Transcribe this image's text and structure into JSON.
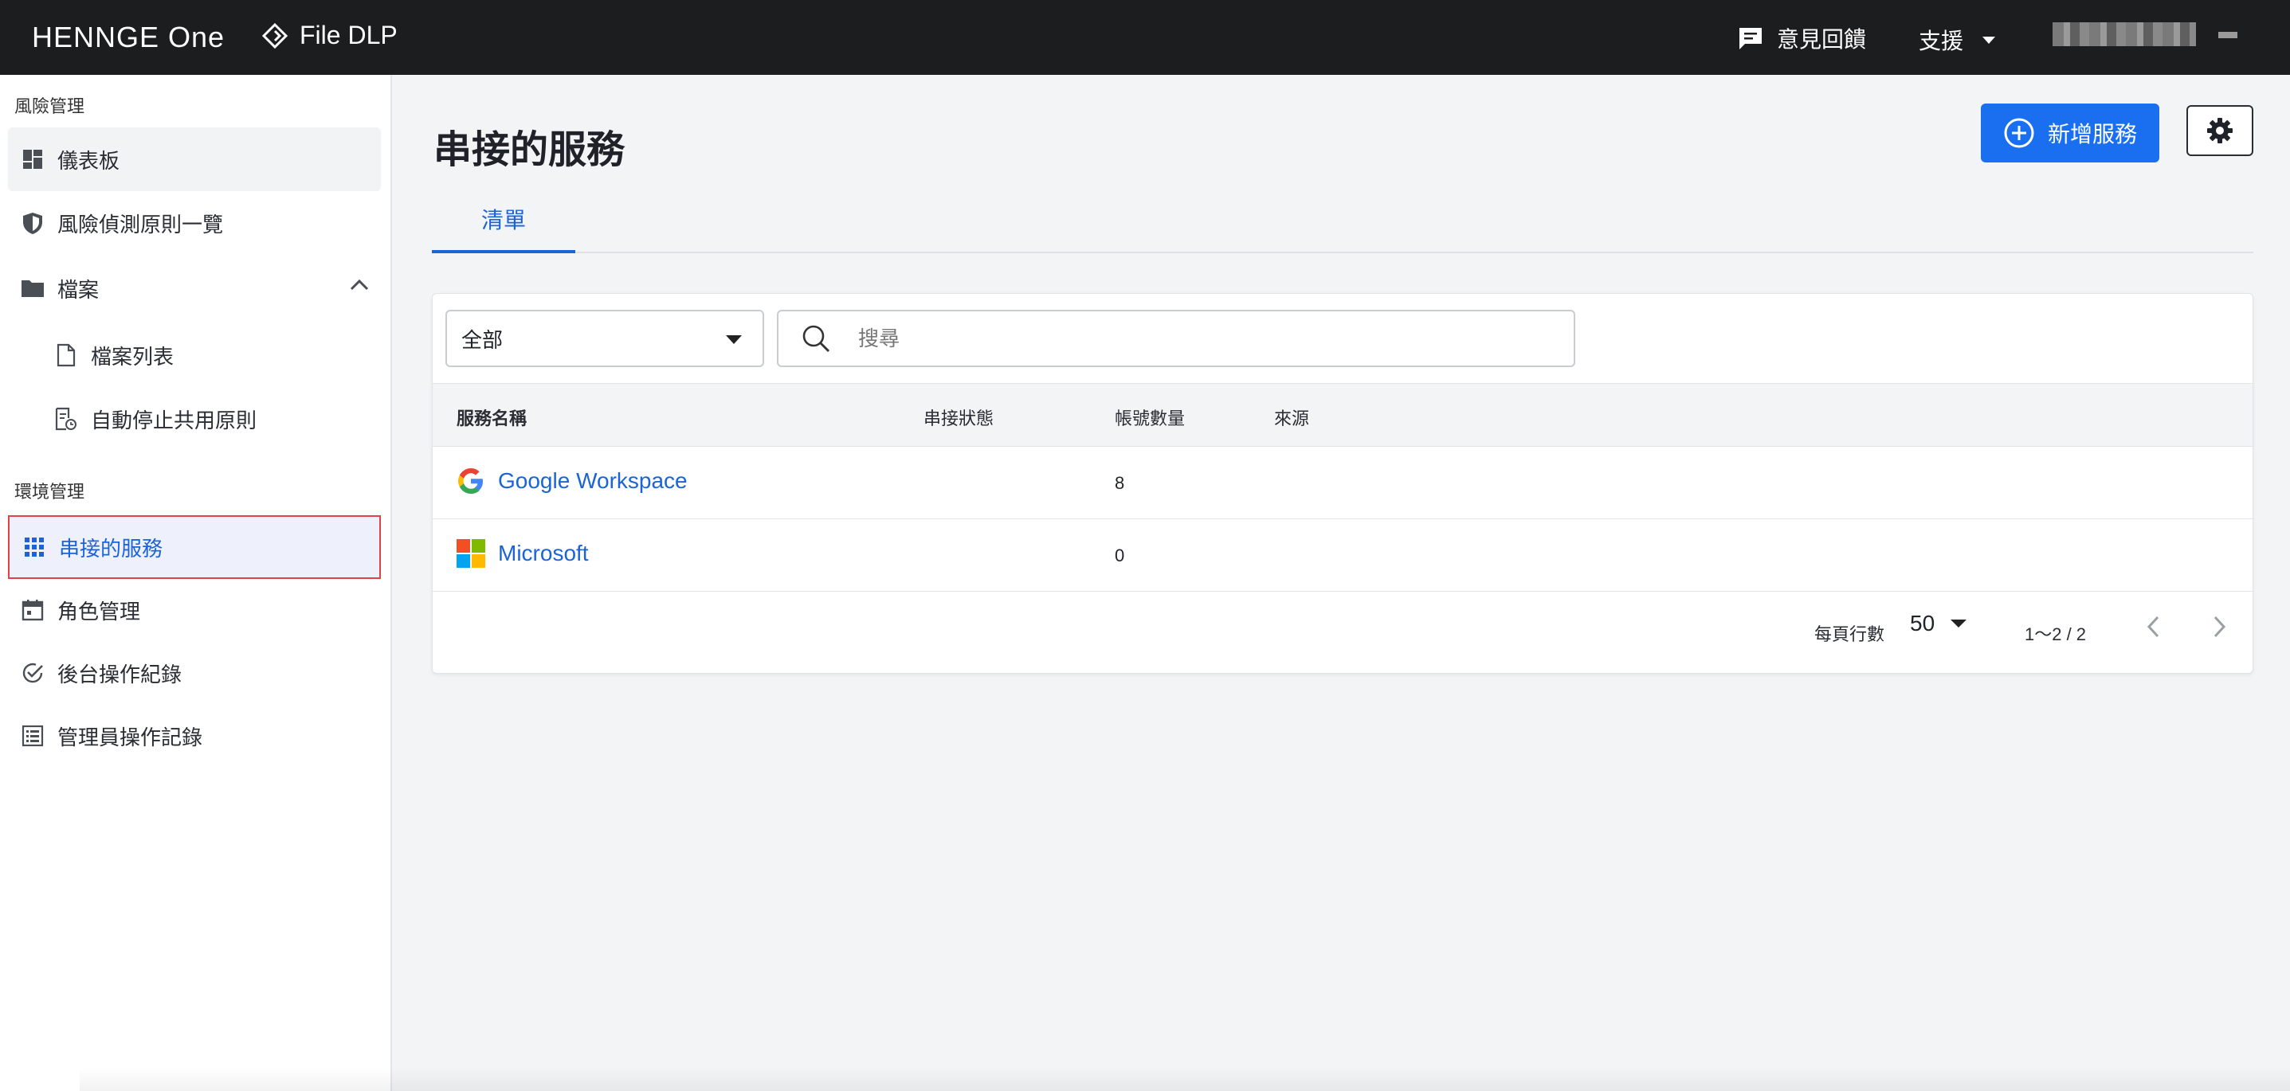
{
  "header": {
    "brand": "HENNGE One",
    "product": "File DLP",
    "feedback_label": "意見回饋",
    "support_label": "支援"
  },
  "sidebar": {
    "section_risk": "風險管理",
    "section_env": "環境管理",
    "items": {
      "dashboard": "儀表板",
      "risk_rules": "風險偵測原則一覽",
      "files": "檔案",
      "file_list": "檔案列表",
      "auto_stop": "自動停止共用原則",
      "connected_services": "串接的服務",
      "roles": "角色管理",
      "backend_logs": "後台操作紀錄",
      "admin_logs": "管理員操作記錄"
    }
  },
  "main": {
    "title": "串接的服務",
    "add_button": "新增服務",
    "tabs": [
      {
        "label": "清單"
      }
    ],
    "filter": {
      "selected": "全部"
    },
    "search": {
      "placeholder": "搜尋"
    },
    "table": {
      "columns": [
        "服務名稱",
        "串接狀態",
        "帳號數量",
        "來源"
      ],
      "rows": [
        {
          "name": "Google Workspace",
          "status": "",
          "accounts": "8",
          "source": "",
          "icon": "google-icon"
        },
        {
          "name": "Microsoft",
          "status": "",
          "accounts": "0",
          "source": "",
          "icon": "microsoft-icon"
        }
      ]
    },
    "pagination": {
      "rows_per_page_label": "每頁行數",
      "rows_per_page": "50",
      "range": "1〜2 / 2"
    }
  },
  "colors": {
    "primary": "#1a6ff0",
    "link": "#1a64d8",
    "header_bg": "#1c1d1f",
    "selection_border": "#e2404a"
  }
}
